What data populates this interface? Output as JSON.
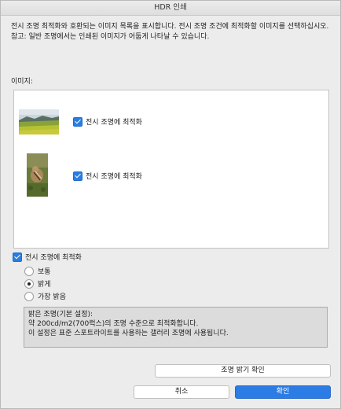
{
  "window": {
    "title": "HDR 인쇄"
  },
  "description": [
    "전시 조명 최적화와 호환되는 이미지 목록을 표시합니다. 전시 조명 조건에 최적화할 이미지를 선택하십시오.",
    "참고: 일반 조명에서는 인쇄된 이미지가 어둡게 나타날 수 있습니다."
  ],
  "images_label": "이미지:",
  "images": [
    {
      "icon": "landscape-thumbnail",
      "check_label": "전시 조명에 최적화",
      "checked": true
    },
    {
      "icon": "chipmunk-thumbnail",
      "check_label": "전시 조명에 최적화",
      "checked": true
    }
  ],
  "optimize_checkbox": {
    "label": "전시 조명에 최적화",
    "checked": true
  },
  "brightness_options": [
    {
      "label": "보통",
      "selected": false
    },
    {
      "label": "밝게",
      "selected": true
    },
    {
      "label": "가장 밝음",
      "selected": false
    }
  ],
  "info": [
    "밝은 조명(기본 설정):",
    "약 200cd/m2(700럭스)의 조명 수준으로 최적화합니다.",
    "이 설정은 표준 스포트라이트를 사용하는 갤러리 조명에 사용됩니다."
  ],
  "buttons": {
    "check_brightness": "조명 밝기 확인",
    "cancel": "취소",
    "ok": "확인"
  },
  "colors": {
    "accent": "#2c7ce6",
    "window_bg": "#ececec"
  }
}
